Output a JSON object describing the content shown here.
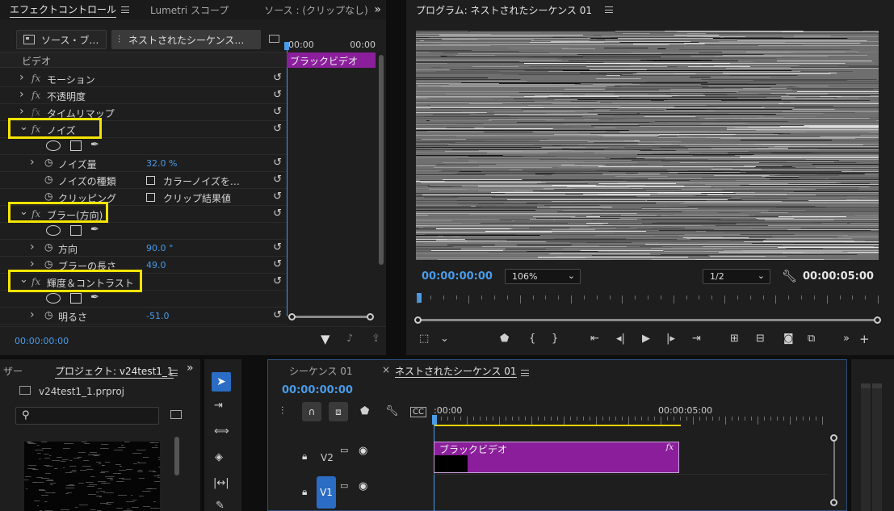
{
  "effect_controls": {
    "tabs": [
      {
        "label": "エフェクトコントロール",
        "active": true
      },
      {
        "label": "Lumetri スコープ",
        "active": false
      },
      {
        "label": "ソース : (クリップなし)",
        "active": false
      }
    ],
    "overflow": "»",
    "source_chip": "ソース・ブ…",
    "sequence_chip": "ネストされたシーケンス…",
    "section_label": "ビデオ",
    "timeline_times": [
      "00:00",
      "00:00"
    ],
    "clip_label": "ブラックビデオ",
    "effects": [
      {
        "name": "モーション"
      },
      {
        "name": "不透明度"
      },
      {
        "name": "タイムリマップ"
      },
      {
        "name": "ノイズ",
        "highlighted": true
      },
      {
        "name": "ブラー(方向)",
        "highlighted": true
      },
      {
        "name": "輝度＆コントラスト",
        "highlighted": true
      }
    ],
    "noise_params": [
      {
        "name": "ノイズ量",
        "value": "32.0 %"
      },
      {
        "name": "ノイズの種類",
        "value": "カラーノイズを…"
      },
      {
        "name": "クリッピング",
        "value": "クリップ結果値"
      }
    ],
    "blur_params": [
      {
        "name": "方向",
        "value": "90.0 °"
      },
      {
        "name": "ブラーの長さ",
        "value": "49.0"
      }
    ],
    "brightness_params": [
      {
        "name": "明るさ",
        "value": "-51.0"
      }
    ],
    "timecode": "00:00:00:00"
  },
  "program": {
    "title": "プログラム: ネストされたシーケンス 01",
    "timecode": "00:00:00:00",
    "zoom": "106%",
    "resolution": "1/2",
    "duration": "00:00:05:00"
  },
  "project": {
    "left_tab": "ザー",
    "tab": "プロジェクト: v24test1_1",
    "file": "v24test1_1.prproj"
  },
  "timeline": {
    "tabs": [
      {
        "label": "シーケンス 01",
        "active": false
      },
      {
        "label": "ネストされたシーケンス 01",
        "active": true
      }
    ],
    "close": "×",
    "timecode": "00:00:00:00",
    "ruler": [
      ":00:00",
      "00:00:05:00"
    ],
    "tracks": [
      {
        "name": "V2",
        "selected": false
      },
      {
        "name": "V1",
        "selected": true
      }
    ],
    "clip_label": "ブラックビデオ",
    "clip_fx": "fx"
  },
  "colors": {
    "accent": "#4a9be8",
    "clip": "#8b1f9b",
    "highlight": "#f5e400",
    "ruler_line": "#e8d000"
  }
}
